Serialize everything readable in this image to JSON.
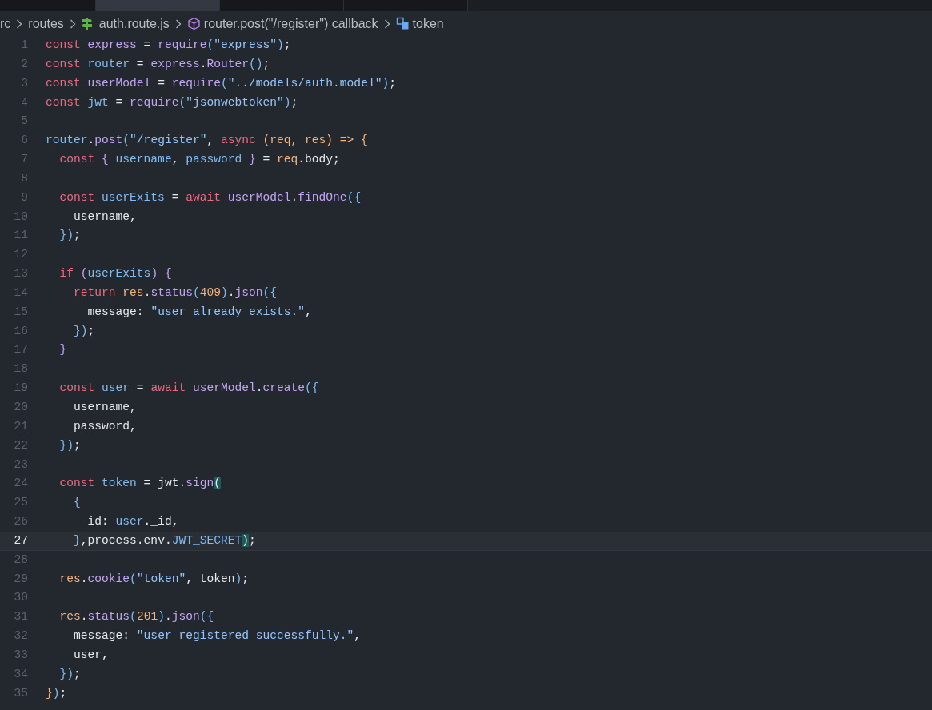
{
  "tabs": [
    {
      "selected": false
    },
    {
      "selected": true
    },
    {
      "selected": false
    },
    {
      "selected": false
    }
  ],
  "breadcrumb": [
    {
      "kind": "text",
      "text": "rc"
    },
    {
      "kind": "text",
      "text": "routes"
    },
    {
      "kind": "file",
      "text": "auth.route.js"
    },
    {
      "kind": "method",
      "text": "router.post(\"/register\") callback"
    },
    {
      "kind": "variable",
      "text": "token"
    }
  ],
  "editor": {
    "lines": [
      {
        "number": "1",
        "active": false,
        "tokens": [
          {
            "kind": "kw",
            "text": "const "
          },
          {
            "kind": "var",
            "text": "express"
          },
          {
            "kind": "plain",
            "text": " = "
          },
          {
            "kind": "fn",
            "text": "require"
          },
          {
            "kind": "brk",
            "text": "("
          },
          {
            "kind": "str",
            "text": "\"express\""
          },
          {
            "kind": "brk",
            "text": ")"
          },
          {
            "kind": "plain",
            "text": ";"
          }
        ]
      },
      {
        "number": "2",
        "active": false,
        "tokens": [
          {
            "kind": "kw",
            "text": "const "
          },
          {
            "kind": "id",
            "text": "router"
          },
          {
            "kind": "plain",
            "text": " = "
          },
          {
            "kind": "var",
            "text": "express"
          },
          {
            "kind": "plain",
            "text": "."
          },
          {
            "kind": "fn",
            "text": "Router"
          },
          {
            "kind": "brk",
            "text": "()"
          },
          {
            "kind": "plain",
            "text": ";"
          }
        ]
      },
      {
        "number": "3",
        "active": false,
        "tokens": [
          {
            "kind": "kw",
            "text": "const "
          },
          {
            "kind": "var",
            "text": "userModel"
          },
          {
            "kind": "plain",
            "text": " = "
          },
          {
            "kind": "fn",
            "text": "require"
          },
          {
            "kind": "brk",
            "text": "("
          },
          {
            "kind": "str",
            "text": "\"../models/auth.model\""
          },
          {
            "kind": "brk",
            "text": ")"
          },
          {
            "kind": "plain",
            "text": ";"
          }
        ]
      },
      {
        "number": "4",
        "active": false,
        "tokens": [
          {
            "kind": "kw",
            "text": "const "
          },
          {
            "kind": "id",
            "text": "jwt"
          },
          {
            "kind": "plain",
            "text": " = "
          },
          {
            "kind": "fn",
            "text": "require"
          },
          {
            "kind": "brk",
            "text": "("
          },
          {
            "kind": "str",
            "text": "\"jsonwebtoken\""
          },
          {
            "kind": "brk",
            "text": ")"
          },
          {
            "kind": "plain",
            "text": ";"
          }
        ]
      },
      {
        "number": "5",
        "active": false
      },
      {
        "number": "6",
        "active": false,
        "tokens": [
          {
            "kind": "id",
            "text": "router"
          },
          {
            "kind": "plain",
            "text": "."
          },
          {
            "kind": "fn",
            "text": "post"
          },
          {
            "kind": "brk",
            "text": "("
          },
          {
            "kind": "str",
            "text": "\"/register\""
          },
          {
            "kind": "plain",
            "text": ", "
          },
          {
            "kind": "kw",
            "text": "async "
          },
          {
            "kind": "param",
            "text": "(req, res) => {"
          }
        ]
      },
      {
        "number": "7",
        "active": false,
        "tokens": [
          {
            "kind": "kw",
            "text": "  const "
          },
          {
            "kind": "fn",
            "text": "{ "
          },
          {
            "kind": "id",
            "text": "username"
          },
          {
            "kind": "plain",
            "text": ", "
          },
          {
            "kind": "id",
            "text": "password "
          },
          {
            "kind": "fn",
            "text": "}"
          },
          {
            "kind": "plain",
            "text": " = "
          },
          {
            "kind": "param",
            "text": "req"
          },
          {
            "kind": "plain",
            "text": ".body;"
          }
        ]
      },
      {
        "number": "8",
        "active": false
      },
      {
        "number": "9",
        "active": false,
        "tokens": [
          {
            "kind": "kw",
            "text": "  const "
          },
          {
            "kind": "id",
            "text": "userExits"
          },
          {
            "kind": "plain",
            "text": " = "
          },
          {
            "kind": "kw",
            "text": "await "
          },
          {
            "kind": "var",
            "text": "userModel"
          },
          {
            "kind": "plain",
            "text": "."
          },
          {
            "kind": "fn",
            "text": "findOne"
          },
          {
            "kind": "brk",
            "text": "({"
          }
        ]
      },
      {
        "number": "10",
        "active": false,
        "tokens": [
          {
            "kind": "plain",
            "text": "    username,"
          }
        ]
      },
      {
        "number": "11",
        "active": false,
        "tokens": [
          {
            "kind": "brk",
            "text": "  })"
          },
          {
            "kind": "plain",
            "text": ";"
          }
        ]
      },
      {
        "number": "12",
        "active": false
      },
      {
        "number": "13",
        "active": false,
        "tokens": [
          {
            "kind": "kw",
            "text": "  if "
          },
          {
            "kind": "fn",
            "text": "("
          },
          {
            "kind": "id",
            "text": "userExits"
          },
          {
            "kind": "fn",
            "text": ") {"
          }
        ]
      },
      {
        "number": "14",
        "active": false,
        "tokens": [
          {
            "kind": "kw",
            "text": "    return "
          },
          {
            "kind": "param",
            "text": "res"
          },
          {
            "kind": "plain",
            "text": "."
          },
          {
            "kind": "fn",
            "text": "status"
          },
          {
            "kind": "brk",
            "text": "("
          },
          {
            "kind": "num",
            "text": "409"
          },
          {
            "kind": "brk",
            "text": ")"
          },
          {
            "kind": "plain",
            "text": "."
          },
          {
            "kind": "fn",
            "text": "json"
          },
          {
            "kind": "brk",
            "text": "({"
          }
        ]
      },
      {
        "number": "15",
        "active": false,
        "tokens": [
          {
            "kind": "plain",
            "text": "      message: "
          },
          {
            "kind": "str",
            "text": "\"user already exists.\""
          },
          {
            "kind": "plain",
            "text": ","
          }
        ]
      },
      {
        "number": "16",
        "active": false,
        "tokens": [
          {
            "kind": "brk",
            "text": "    })"
          },
          {
            "kind": "plain",
            "text": ";"
          }
        ]
      },
      {
        "number": "17",
        "active": false,
        "tokens": [
          {
            "kind": "fn",
            "text": "  }"
          }
        ]
      },
      {
        "number": "18",
        "active": false
      },
      {
        "number": "19",
        "active": false,
        "tokens": [
          {
            "kind": "kw",
            "text": "  const "
          },
          {
            "kind": "id",
            "text": "user"
          },
          {
            "kind": "plain",
            "text": " = "
          },
          {
            "kind": "kw",
            "text": "await "
          },
          {
            "kind": "var",
            "text": "userModel"
          },
          {
            "kind": "plain",
            "text": "."
          },
          {
            "kind": "fn",
            "text": "create"
          },
          {
            "kind": "brk",
            "text": "({"
          }
        ]
      },
      {
        "number": "20",
        "active": false,
        "tokens": [
          {
            "kind": "plain",
            "text": "    username,"
          }
        ]
      },
      {
        "number": "21",
        "active": false,
        "tokens": [
          {
            "kind": "plain",
            "text": "    password,"
          }
        ]
      },
      {
        "number": "22",
        "active": false,
        "tokens": [
          {
            "kind": "brk",
            "text": "  })"
          },
          {
            "kind": "plain",
            "text": ";"
          }
        ]
      },
      {
        "number": "23",
        "active": false
      },
      {
        "number": "24",
        "active": false,
        "tokens": [
          {
            "kind": "kw",
            "text": "  const "
          },
          {
            "kind": "id",
            "text": "token"
          },
          {
            "kind": "plain",
            "text": " = jwt."
          },
          {
            "kind": "fn",
            "text": "sign"
          },
          {
            "kind": "match",
            "text": "("
          }
        ]
      },
      {
        "number": "25",
        "active": false,
        "tokens": [
          {
            "kind": "id",
            "text": "    {"
          }
        ]
      },
      {
        "number": "26",
        "active": false,
        "tokens": [
          {
            "kind": "plain",
            "text": "      id: "
          },
          {
            "kind": "id",
            "text": "user"
          },
          {
            "kind": "plain",
            "text": "._id,"
          }
        ]
      },
      {
        "number": "27",
        "active": true,
        "tokens": [
          {
            "kind": "id",
            "text": "    }"
          },
          {
            "kind": "plain",
            "text": ",process.env."
          },
          {
            "kind": "id",
            "text": "JWT_SECRET"
          },
          {
            "kind": "match",
            "text": ")"
          },
          {
            "kind": "plain",
            "text": ";"
          }
        ]
      },
      {
        "number": "28",
        "active": false
      },
      {
        "number": "29",
        "active": false,
        "tokens": [
          {
            "kind": "param",
            "text": "  res"
          },
          {
            "kind": "plain",
            "text": "."
          },
          {
            "kind": "fn",
            "text": "cookie"
          },
          {
            "kind": "brk",
            "text": "("
          },
          {
            "kind": "str",
            "text": "\"token\""
          },
          {
            "kind": "plain",
            "text": ", token"
          },
          {
            "kind": "brk",
            "text": ")"
          },
          {
            "kind": "plain",
            "text": ";"
          }
        ]
      },
      {
        "number": "30",
        "active": false
      },
      {
        "number": "31",
        "active": false,
        "tokens": [
          {
            "kind": "param",
            "text": "  res"
          },
          {
            "kind": "plain",
            "text": "."
          },
          {
            "kind": "fn",
            "text": "status"
          },
          {
            "kind": "brk",
            "text": "("
          },
          {
            "kind": "num",
            "text": "201"
          },
          {
            "kind": "brk",
            "text": ")"
          },
          {
            "kind": "plain",
            "text": "."
          },
          {
            "kind": "fn",
            "text": "json"
          },
          {
            "kind": "brk",
            "text": "({"
          }
        ]
      },
      {
        "number": "32",
        "active": false,
        "tokens": [
          {
            "kind": "plain",
            "text": "    message: "
          },
          {
            "kind": "str",
            "text": "\"user registered successfully.\""
          },
          {
            "kind": "plain",
            "text": ","
          }
        ]
      },
      {
        "number": "33",
        "active": false,
        "tokens": [
          {
            "kind": "plain",
            "text": "    user,"
          }
        ]
      },
      {
        "number": "34",
        "active": false,
        "tokens": [
          {
            "kind": "brk",
            "text": "  })"
          },
          {
            "kind": "plain",
            "text": ";"
          }
        ]
      },
      {
        "number": "35",
        "active": false,
        "tokens": [
          {
            "kind": "param",
            "text": "}"
          },
          {
            "kind": "brk",
            "text": ")"
          },
          {
            "kind": "plain",
            "text": ";"
          }
        ]
      }
    ]
  }
}
